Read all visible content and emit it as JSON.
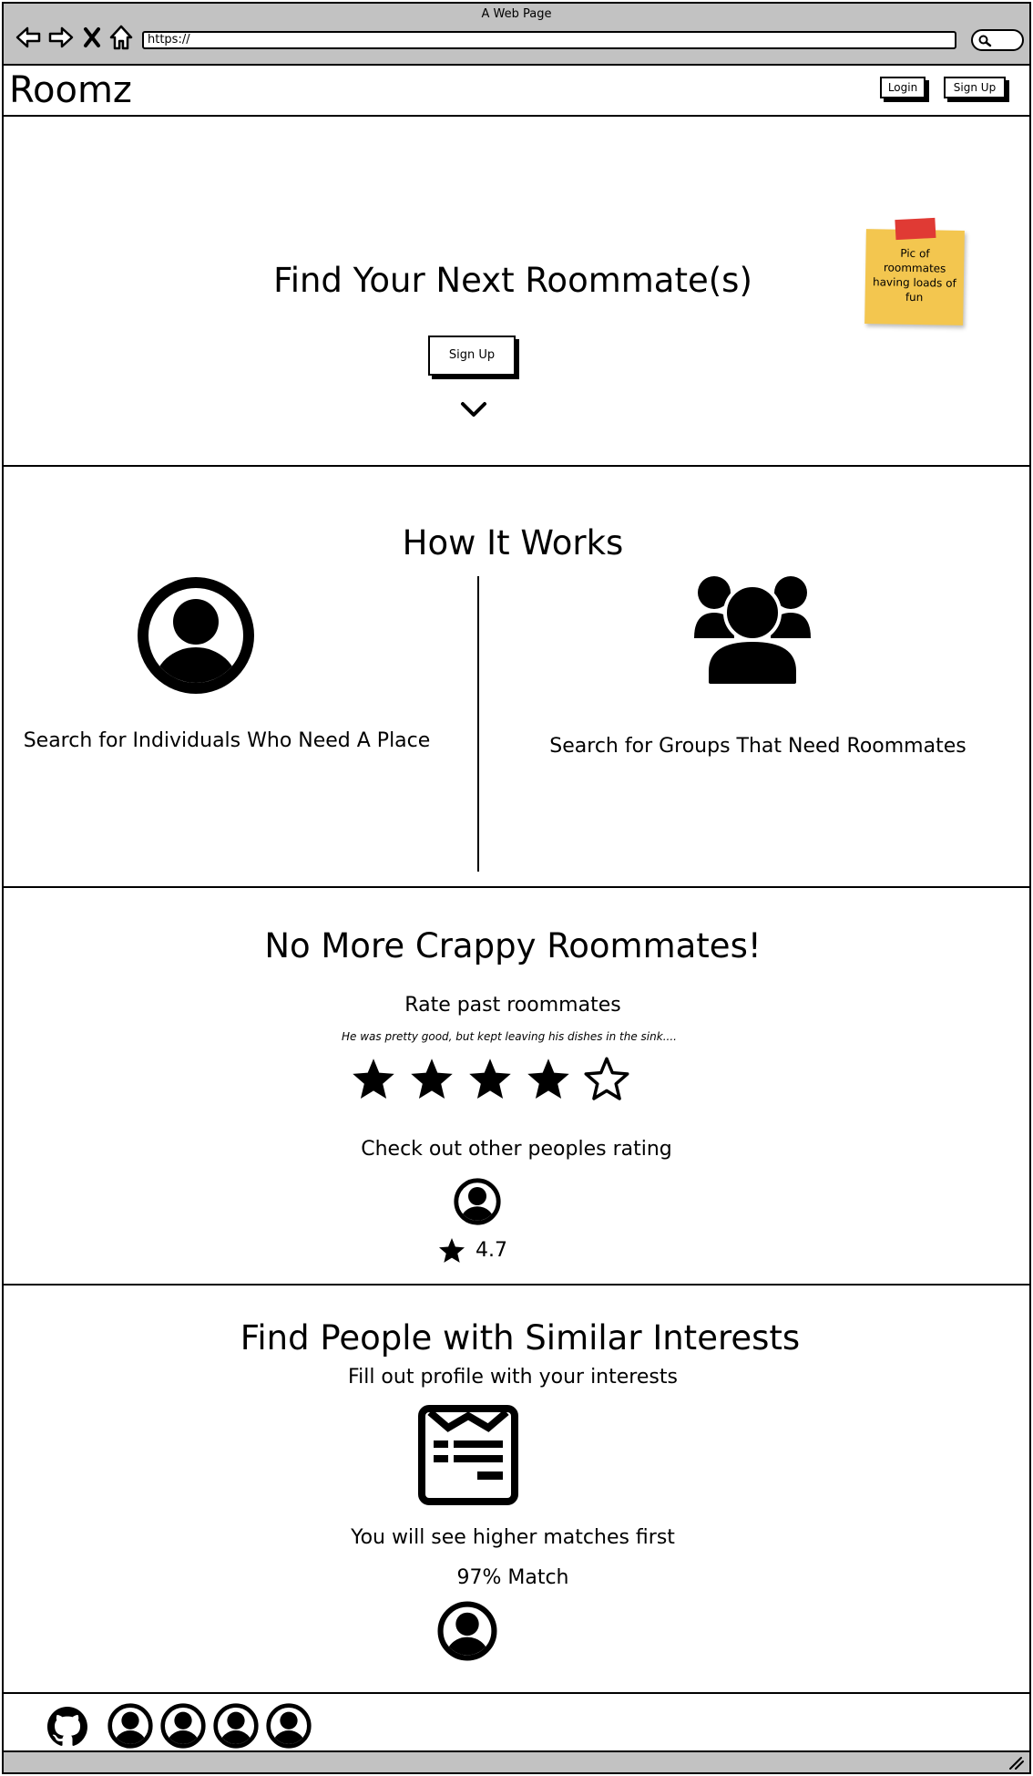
{
  "browser": {
    "window_title": "A Web Page",
    "url": "https://",
    "nav_icons": [
      "back-arrow-icon",
      "forward-arrow-icon",
      "close-x-icon",
      "home-icon"
    ],
    "search_icon": "search-icon",
    "chrome_color": "#c2c2c2"
  },
  "header": {
    "logo": "Roomz",
    "login_label": "Login",
    "signup_label": "Sign Up"
  },
  "hero": {
    "headline": "Find Your Next Roommate(s)",
    "signup_label": "Sign Up",
    "scroll_icon": "chevron-down-icon",
    "sticky_note": "Pic of roommates having loads of fun",
    "sticky_color": "#f3c64f",
    "tape_color": "#e03a34"
  },
  "how_it_works": {
    "title": "How It Works",
    "individuals_label": "Search for Individuals Who Need A Place",
    "groups_label": "Search for Groups That Need Roommates",
    "individual_icon": "user-circle-icon",
    "group_icon": "group-icon"
  },
  "ratings": {
    "title": "No More Crappy Roommates!",
    "rate_heading": "Rate past roommates",
    "review_quote": "He was pretty good, but kept leaving his dishes in the sink....",
    "stars_filled": 4,
    "stars_total": 5,
    "check_heading": "Check out other peoples rating",
    "score": "4.7"
  },
  "interests": {
    "title": "Find People with Similar Interests",
    "profile_text": "Fill out profile with your interests",
    "form_icon": "profile-form-icon",
    "matches_text": "You will see higher matches first",
    "match_label": "97% Match"
  },
  "footer": {
    "github_icon": "github-icon",
    "member_avatars": 4
  }
}
